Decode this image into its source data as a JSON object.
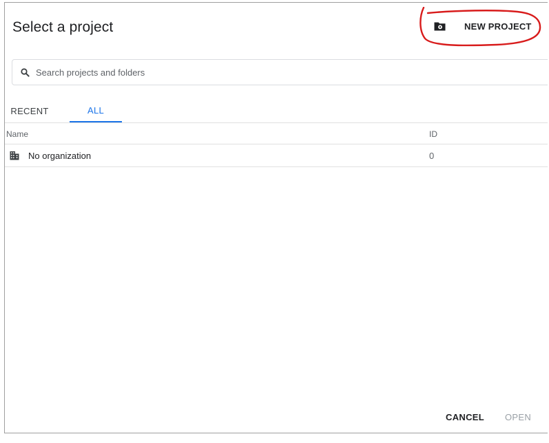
{
  "dialog": {
    "title": "Select a project",
    "new_project_label": "NEW PROJECT",
    "new_project_icon": "folder-settings-icon",
    "annotation_color": "#d81b1b"
  },
  "search": {
    "placeholder": "Search projects and folders",
    "value": "",
    "icon": "search-icon"
  },
  "tabs": [
    {
      "label": "RECENT",
      "active": false
    },
    {
      "label": "ALL",
      "active": true
    }
  ],
  "accent_color": "#1a73e8",
  "table": {
    "columns": [
      "Name",
      "ID"
    ],
    "rows": [
      {
        "icon": "organization-icon",
        "name": "No organization",
        "id": "0"
      }
    ]
  },
  "footer": {
    "cancel_label": "CANCEL",
    "open_label": "OPEN",
    "open_enabled": false
  }
}
